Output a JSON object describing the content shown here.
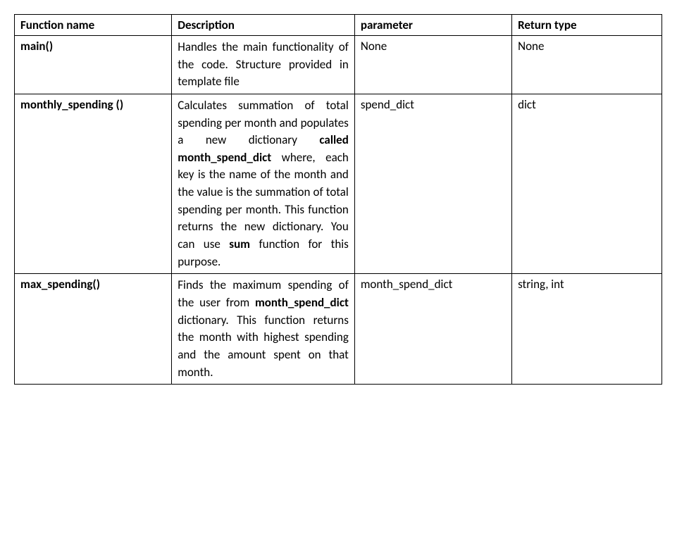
{
  "table": {
    "headers": {
      "func": "Function name",
      "desc": "Description",
      "param": "parameter",
      "return": "Return type"
    },
    "rows": [
      {
        "func": "main()",
        "desc_parts": {
          "p0": "Handles the main functionality of the code. Structure provided in template file"
        },
        "param": "None",
        "return": "None"
      },
      {
        "func": "monthly_spending ()",
        "desc_parts": {
          "p0": "Calculates summation of total spending per month and populates a new dictionary ",
          "b0": "called month_spend_dict",
          "p1": " where, each key is the name of the month and the value is the summation of total spending per month. This function returns the new dictionary. You can use ",
          "b1": "sum",
          "p2": " function for this purpose."
        },
        "param": "spend_dict",
        "return": "dict"
      },
      {
        "func": "max_spending()",
        "desc_parts": {
          "p0": "Finds the maximum spending of the user from ",
          "b0": "month_spend_dict",
          "p1": " dictionary. This function returns the month with highest spending and the amount spent on that month."
        },
        "param": "month_spend_dict",
        "return": "string, int"
      }
    ]
  }
}
